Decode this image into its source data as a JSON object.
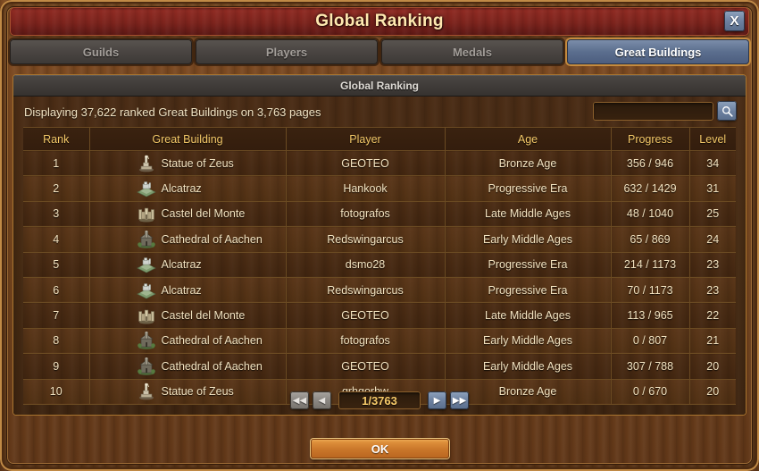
{
  "window": {
    "title": "Global Ranking",
    "close_label": "X"
  },
  "tabs": [
    {
      "label": "Guilds",
      "active": false
    },
    {
      "label": "Players",
      "active": false
    },
    {
      "label": "Medals",
      "active": false
    },
    {
      "label": "Great Buildings",
      "active": true
    }
  ],
  "panel": {
    "header": "Global Ranking",
    "info_text": "Displaying 37,622 ranked Great Buildings on 3,763 pages",
    "search": {
      "value": "",
      "placeholder": "",
      "icon": "search-icon"
    }
  },
  "table": {
    "columns": [
      "Rank",
      "Great Building",
      "Player",
      "Age",
      "Progress",
      "Level"
    ],
    "rows": [
      {
        "rank": "1",
        "building": "Statue of Zeus",
        "icon": "statue-of-zeus-icon",
        "player": "GEOTEO",
        "age": "Bronze Age",
        "progress": "356 / 946",
        "level": "34"
      },
      {
        "rank": "2",
        "building": "Alcatraz",
        "icon": "alcatraz-icon",
        "player": "Hankook",
        "age": "Progressive Era",
        "progress": "632 / 1429",
        "level": "31"
      },
      {
        "rank": "3",
        "building": "Castel del Monte",
        "icon": "castel-del-monte-icon",
        "player": "fotografos",
        "age": "Late Middle Ages",
        "progress": "48 / 1040",
        "level": "25"
      },
      {
        "rank": "4",
        "building": "Cathedral of Aachen",
        "icon": "cathedral-of-aachen-icon",
        "player": "Redswingarcus",
        "age": "Early Middle Ages",
        "progress": "65 / 869",
        "level": "24"
      },
      {
        "rank": "5",
        "building": "Alcatraz",
        "icon": "alcatraz-icon",
        "player": "dsmo28",
        "age": "Progressive Era",
        "progress": "214 / 1173",
        "level": "23"
      },
      {
        "rank": "6",
        "building": "Alcatraz",
        "icon": "alcatraz-icon",
        "player": "Redswingarcus",
        "age": "Progressive Era",
        "progress": "70 / 1173",
        "level": "23"
      },
      {
        "rank": "7",
        "building": "Castel del Monte",
        "icon": "castel-del-monte-icon",
        "player": "GEOTEO",
        "age": "Late Middle Ages",
        "progress": "113 / 965",
        "level": "22"
      },
      {
        "rank": "8",
        "building": "Cathedral of Aachen",
        "icon": "cathedral-of-aachen-icon",
        "player": "fotografos",
        "age": "Early Middle Ages",
        "progress": "0 / 807",
        "level": "21"
      },
      {
        "rank": "9",
        "building": "Cathedral of Aachen",
        "icon": "cathedral-of-aachen-icon",
        "player": "GEOTEO",
        "age": "Early Middle Ages",
        "progress": "307 / 788",
        "level": "20"
      },
      {
        "rank": "10",
        "building": "Statue of Zeus",
        "icon": "statue-of-zeus-icon",
        "player": "grhgorhw",
        "age": "Bronze Age",
        "progress": "0 / 670",
        "level": "20"
      }
    ]
  },
  "pagination": {
    "first_label": "◀◀",
    "prev_label": "◀",
    "page_value": "1/3763",
    "next_label": "▶",
    "last_label": "▶▶",
    "first_enabled": false,
    "prev_enabled": false,
    "next_enabled": true,
    "last_enabled": true
  },
  "footer": {
    "ok_label": "OK"
  },
  "colors": {
    "accent_gold": "#f5c968",
    "title_red": "#7c231c",
    "tab_active_blue": "#5b6e8e",
    "wood_brown": "#4a2c15",
    "ok_orange": "#c9762a"
  }
}
